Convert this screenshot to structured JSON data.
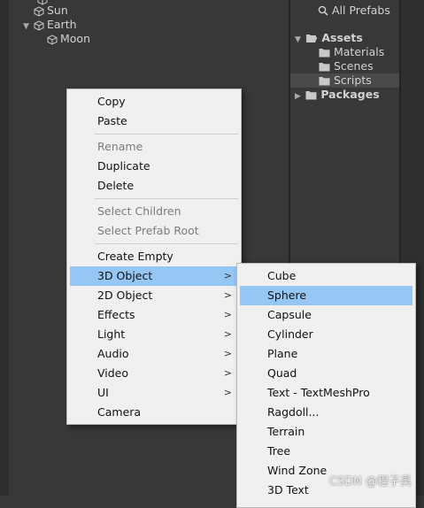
{
  "hierarchy": {
    "items": [
      {
        "label": "Sun"
      },
      {
        "label": "Earth"
      },
      {
        "label": "Moon"
      }
    ]
  },
  "project": {
    "all_prefabs": "All Prefabs",
    "assets": "Assets",
    "folders": [
      {
        "label": "Materials"
      },
      {
        "label": "Scenes"
      },
      {
        "label": "Scripts"
      }
    ],
    "packages": "Packages"
  },
  "context_menu": {
    "items": [
      {
        "label": "Copy"
      },
      {
        "label": "Paste"
      },
      {
        "label": "Rename"
      },
      {
        "label": "Duplicate"
      },
      {
        "label": "Delete"
      },
      {
        "label": "Select Children"
      },
      {
        "label": "Select Prefab Root"
      },
      {
        "label": "Create Empty"
      },
      {
        "label": "3D Object"
      },
      {
        "label": "2D Object"
      },
      {
        "label": "Effects"
      },
      {
        "label": "Light"
      },
      {
        "label": "Audio"
      },
      {
        "label": "Video"
      },
      {
        "label": "UI"
      },
      {
        "label": "Camera"
      }
    ]
  },
  "submenu_3d": {
    "items": [
      {
        "label": "Cube"
      },
      {
        "label": "Sphere"
      },
      {
        "label": "Capsule"
      },
      {
        "label": "Cylinder"
      },
      {
        "label": "Plane"
      },
      {
        "label": "Quad"
      },
      {
        "label": "Text - TextMeshPro"
      },
      {
        "label": "Ragdoll..."
      },
      {
        "label": "Terrain"
      },
      {
        "label": "Tree"
      },
      {
        "label": "Wind Zone"
      },
      {
        "label": "3D Text"
      }
    ]
  },
  "watermark": "CSDN @程子昊",
  "colors": {
    "highlight": "#96c6f3",
    "menu_bg": "#f0f0f0",
    "editor_bg": "#383838"
  }
}
